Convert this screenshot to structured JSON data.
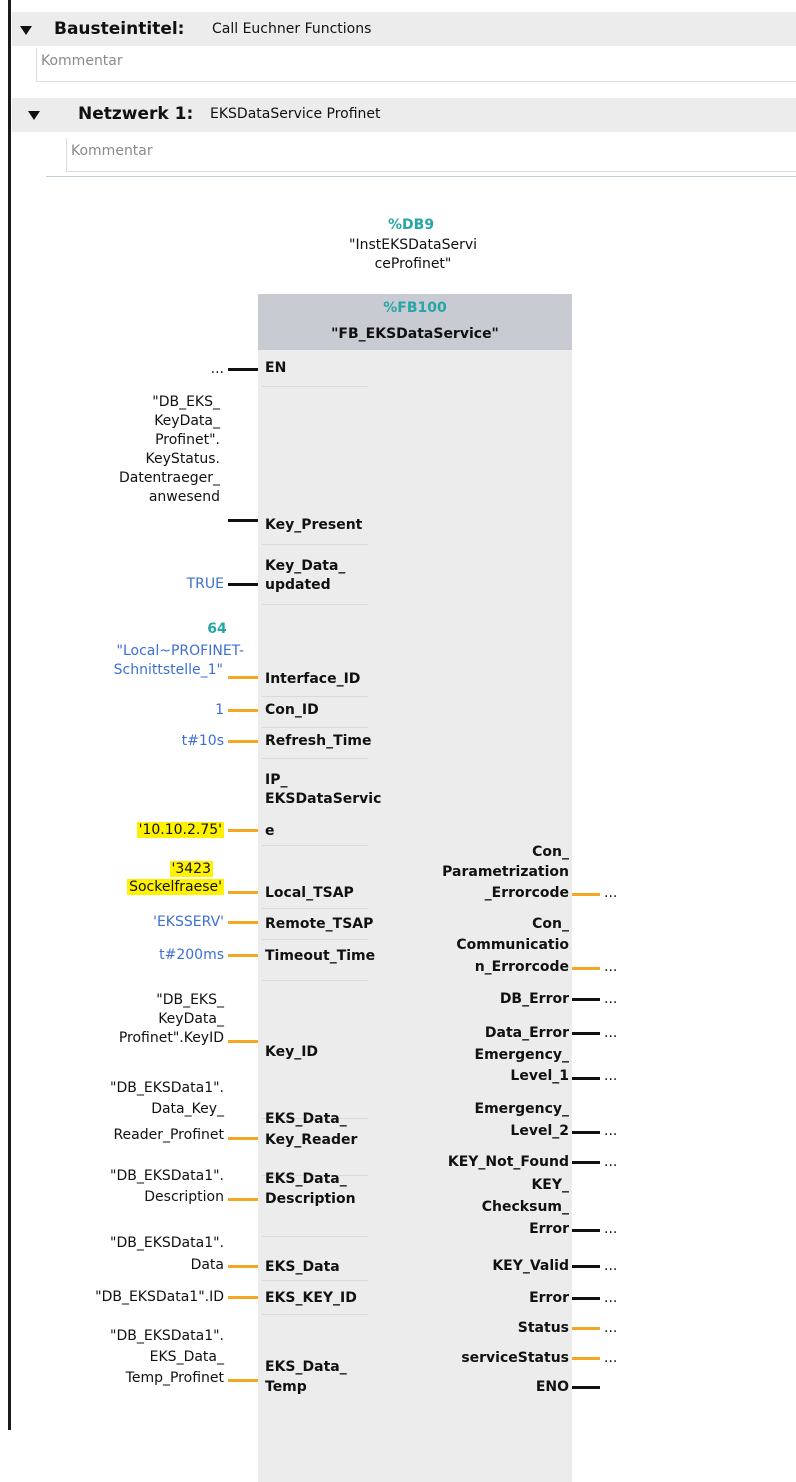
{
  "block_title": {
    "key": "Bausteintitel:",
    "value": "Call Euchner Functions",
    "comment": "Kommentar"
  },
  "network": {
    "key": "Netzwerk 1:",
    "value": "EKSDataService Profinet",
    "comment": "Kommentar"
  },
  "instance": {
    "db": "%DB9",
    "name_line1": "\"InstEKSDataServi",
    "name_line2": "ceProfinet\""
  },
  "fb": {
    "number": "%FB100",
    "name": "\"FB_EKSDataService\""
  },
  "inputs": {
    "en": {
      "pin": "EN",
      "arg": "..."
    },
    "key_present": {
      "pin": "Key_Present",
      "arg": [
        "\"DB_EKS_",
        "KeyData_",
        "Profinet\".",
        "KeyStatus.",
        "Datentraeger_",
        "anwesend"
      ]
    },
    "key_data_updated": {
      "pin": [
        "Key_Data_",
        "updated"
      ],
      "arg": "TRUE"
    },
    "interface_id": {
      "pin": "Interface_ID",
      "arg_num": "64",
      "arg": [
        "\"Local~PROFINET-",
        "Schnittstelle_1\""
      ]
    },
    "con_id": {
      "pin": "Con_ID",
      "arg": "1"
    },
    "refresh_time": {
      "pin": "Refresh_Time",
      "arg": "t#10s"
    },
    "ip": {
      "pin": [
        "IP_",
        "EKSDataServic",
        "e"
      ],
      "arg": "'10.10.2.75'"
    },
    "local_tsap": {
      "pin": "Local_TSAP",
      "arg": [
        "'3423",
        "Sockelfraese'"
      ]
    },
    "remote_tsap": {
      "pin": "Remote_TSAP",
      "arg": "'EKSSERV'"
    },
    "timeout_time": {
      "pin": "Timeout_Time",
      "arg": "t#200ms"
    },
    "key_id": {
      "pin": "Key_ID",
      "arg": [
        "\"DB_EKS_",
        "KeyData_",
        "Profinet\".KeyID"
      ]
    },
    "eks_data_key_reader": {
      "pin": [
        "EKS_Data_",
        "Key_Reader"
      ],
      "arg": [
        "\"DB_EKSData1\".",
        "Data_Key_",
        "Reader_Profinet"
      ]
    },
    "eks_data_description": {
      "pin": [
        "EKS_Data_",
        "Description"
      ],
      "arg": [
        "\"DB_EKSData1\".",
        "Description"
      ]
    },
    "eks_data": {
      "pin": "EKS_Data",
      "arg": [
        "\"DB_EKSData1\".",
        "Data"
      ]
    },
    "eks_key_id": {
      "pin": "EKS_KEY_ID",
      "arg": "\"DB_EKSData1\".ID"
    },
    "eks_data_temp": {
      "pin": [
        "EKS_Data_",
        "Temp"
      ],
      "arg": [
        "\"DB_EKSData1\".",
        "EKS_Data_",
        "Temp_Profinet"
      ]
    }
  },
  "outputs": {
    "con_param": {
      "pin": [
        "Con_",
        "Parametrization",
        "_Errorcode"
      ],
      "arg": "..."
    },
    "con_comm": {
      "pin": [
        "Con_",
        "Communicatio",
        "n_Errorcode"
      ],
      "arg": "..."
    },
    "db_error": {
      "pin": "DB_Error",
      "arg": "..."
    },
    "data_error": {
      "pin": "Data_Error",
      "arg": "..."
    },
    "emergency1": {
      "pin": [
        "Emergency_",
        "Level_1"
      ],
      "arg": "..."
    },
    "emergency2": {
      "pin": [
        "Emergency_",
        "Level_2"
      ],
      "arg": "..."
    },
    "key_not_found": {
      "pin": "KEY_Not_Found",
      "arg": "..."
    },
    "key_checksum": {
      "pin": [
        "KEY_",
        "Checksum_",
        "Error"
      ],
      "arg": "..."
    },
    "key_valid": {
      "pin": "KEY_Valid",
      "arg": "..."
    },
    "error": {
      "pin": "Error",
      "arg": "..."
    },
    "status": {
      "pin": "Status",
      "arg": "..."
    },
    "service_status": {
      "pin": "serviceStatus",
      "arg": "..."
    },
    "eno": {
      "pin": "ENO"
    }
  },
  "colors": {
    "bool_wire": "#111111",
    "data_wire": "#f5a623",
    "highlight": "#fff200",
    "constant": "#3d6fd3",
    "address": "#26a6a6"
  }
}
